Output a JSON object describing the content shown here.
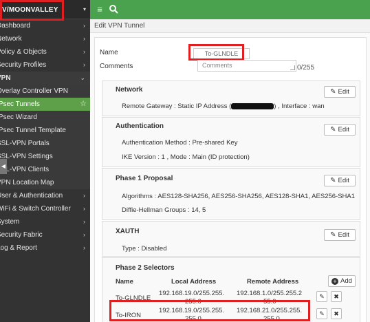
{
  "vdom": {
    "label": "V/MOONVALLEY"
  },
  "sidebar": {
    "items": [
      {
        "label": "Dashboard",
        "chev": "›"
      },
      {
        "label": "Network",
        "chev": "›"
      },
      {
        "label": "Policy & Objects",
        "chev": "›"
      },
      {
        "label": "Security Profiles",
        "chev": "›"
      },
      {
        "label": "VPN",
        "chev": "⌄"
      },
      {
        "label": "Overlay Controller VPN"
      },
      {
        "label": "IPsec Tunnels",
        "star": "☆"
      },
      {
        "label": "IPsec Wizard"
      },
      {
        "label": "IPsec Tunnel Template"
      },
      {
        "label": "SSL-VPN Portals"
      },
      {
        "label": "SSL-VPN Settings"
      },
      {
        "label": "SSL-VPN Clients"
      },
      {
        "label": "VPN Location Map"
      },
      {
        "label": "User & Authentication",
        "chev": "›"
      },
      {
        "label": "WiFi & Switch Controller",
        "chev": "›"
      },
      {
        "label": "System",
        "chev": "›"
      },
      {
        "label": "Security Fabric",
        "chev": "›"
      },
      {
        "label": "Log & Report",
        "chev": "›"
      }
    ]
  },
  "topbar": {
    "menu_icon": "≡",
    "search_icon": "🔍"
  },
  "page_title": "Edit VPN Tunnel",
  "form": {
    "name_label": "Name",
    "name_value": "To-GLNDLE",
    "comments_label": "Comments",
    "comments_placeholder": "Comments",
    "comments_count": "0/255"
  },
  "edit_label": "Edit",
  "network": {
    "title": "Network",
    "remote_gateway_prefix": "Remote Gateway : Static IP Address (",
    "remote_gateway_suffix": ") , Interface : wan"
  },
  "authentication": {
    "title": "Authentication",
    "method": "Authentication Method : Pre-shared Key",
    "ike": "IKE Version : 1 , Mode : Main (ID protection)"
  },
  "phase1": {
    "title": "Phase 1 Proposal",
    "algorithms": "Algorithms : AES128-SHA256, AES256-SHA256, AES128-SHA1, AES256-SHA1",
    "dh": "Diffie-Hellman Groups : 14, 5"
  },
  "xauth": {
    "title": "XAUTH",
    "type": "Type : Disabled"
  },
  "phase2": {
    "title": "Phase 2 Selectors",
    "add_label": "Add",
    "headers": [
      "Name",
      "Local Address",
      "Remote Address"
    ],
    "rows": [
      {
        "name": "To-GLNDLE",
        "local_1": "192.168.19.0/255.255.",
        "local_2": "255.0",
        "remote_1": "192.168.1.0/255.255.2",
        "remote_2": "55.0"
      },
      {
        "name": "To-IRON",
        "local_1": "192.168.19.0/255.255.",
        "local_2": "255.0",
        "remote_1": "192.168.21.0/255.255.",
        "remote_2": "255.0"
      }
    ]
  },
  "colors": {
    "accent": "#4aa14e",
    "active_nav": "#5ea04a",
    "sidebar_bg": "#333333",
    "highlight": "#e02020"
  }
}
